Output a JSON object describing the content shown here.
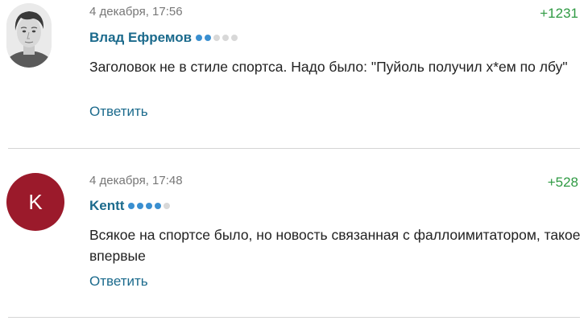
{
  "comments": [
    {
      "date": "4 декабря, 17:56",
      "rating": "+1231",
      "author": "Влад Ефремов",
      "level": 2,
      "level_max": 5,
      "text": "Заголовок не в стиле спортса. Надо было: \"Пуйоль получил х*ем по лбу\"",
      "reply_label": "Ответить",
      "avatar_icon": "user-photo-icon"
    },
    {
      "date": "4 декабря, 17:48",
      "rating": "+528",
      "author": "Kentt",
      "level": 4,
      "level_max": 5,
      "avatar_letter": "K",
      "avatar_color": "#9b1a2b",
      "text": "Всякое на спортсе было, но новость связанная с фаллоимитатором, такое впервые",
      "reply_label": "Ответить"
    }
  ],
  "colors": {
    "author": "#1b6a8c",
    "rating_positive": "#2f9a43",
    "level_dot_on": "#3a8fd0",
    "level_dot_off": "#d8d8d8"
  }
}
